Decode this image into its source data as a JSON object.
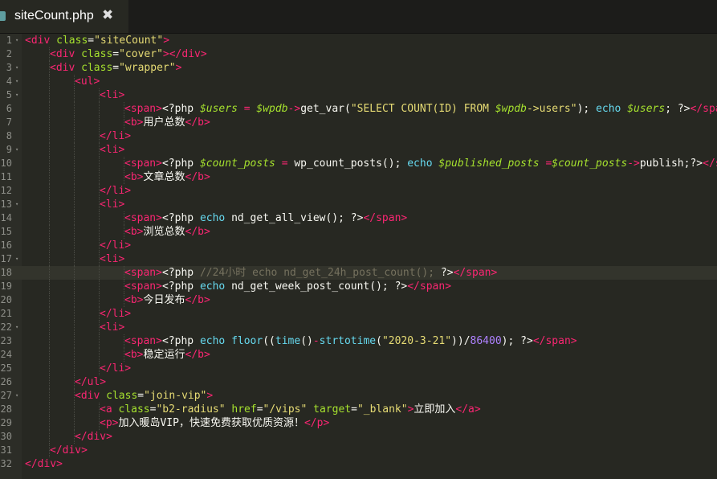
{
  "tab": {
    "title": "siteCount.php",
    "close_glyph": "✖",
    "icon": "file-icon"
  },
  "editor": {
    "active_line": 18,
    "lines": [
      {
        "n": "1",
        "fold": true,
        "indent": 0,
        "tokens": [
          [
            "tag",
            "<div"
          ],
          [
            "txt",
            " "
          ],
          [
            "attr",
            "class"
          ],
          [
            "txt",
            "="
          ],
          [
            "str",
            "\"siteCount\""
          ],
          [
            "tag",
            ">"
          ]
        ]
      },
      {
        "n": "2",
        "fold": false,
        "indent": 1,
        "tokens": [
          [
            "tag",
            "<div"
          ],
          [
            "txt",
            " "
          ],
          [
            "attr",
            "class"
          ],
          [
            "txt",
            "="
          ],
          [
            "str",
            "\"cover\""
          ],
          [
            "tag",
            "></div>"
          ]
        ]
      },
      {
        "n": "3",
        "fold": true,
        "indent": 1,
        "tokens": [
          [
            "tag",
            "<div"
          ],
          [
            "txt",
            " "
          ],
          [
            "attr",
            "class"
          ],
          [
            "txt",
            "="
          ],
          [
            "str",
            "\"wrapper\""
          ],
          [
            "tag",
            ">"
          ]
        ]
      },
      {
        "n": "4",
        "fold": true,
        "indent": 2,
        "tokens": [
          [
            "tag",
            "<ul>"
          ]
        ]
      },
      {
        "n": "5",
        "fold": true,
        "indent": 3,
        "tokens": [
          [
            "tag",
            "<li>"
          ]
        ]
      },
      {
        "n": "6",
        "fold": false,
        "indent": 4,
        "tokens": [
          [
            "tag",
            "<span>"
          ],
          [
            "txt",
            "<?php "
          ],
          [
            "var",
            "$users"
          ],
          [
            "txt",
            " "
          ],
          [
            "op",
            "="
          ],
          [
            "txt",
            " "
          ],
          [
            "var",
            "$wpdb"
          ],
          [
            "op",
            "->"
          ],
          [
            "txt",
            "get_var("
          ],
          [
            "str",
            "\"SELECT COUNT(ID) FROM "
          ],
          [
            "var",
            "$wpdb"
          ],
          [
            "str",
            "->users\""
          ],
          [
            "txt",
            "); "
          ],
          [
            "kw",
            "echo"
          ],
          [
            "txt",
            " "
          ],
          [
            "var",
            "$users"
          ],
          [
            "txt",
            "; ?>"
          ],
          [
            "tag",
            "</span>"
          ]
        ]
      },
      {
        "n": "7",
        "fold": false,
        "indent": 4,
        "tokens": [
          [
            "tag",
            "<b>"
          ],
          [
            "txt",
            "用户总数"
          ],
          [
            "tag",
            "</b>"
          ]
        ]
      },
      {
        "n": "8",
        "fold": false,
        "indent": 3,
        "tokens": [
          [
            "tag",
            "</li>"
          ]
        ]
      },
      {
        "n": "9",
        "fold": true,
        "indent": 3,
        "tokens": [
          [
            "tag",
            "<li>"
          ]
        ]
      },
      {
        "n": "10",
        "fold": false,
        "indent": 4,
        "tokens": [
          [
            "tag",
            "<span>"
          ],
          [
            "txt",
            "<?php "
          ],
          [
            "var",
            "$count_posts"
          ],
          [
            "txt",
            " "
          ],
          [
            "op",
            "="
          ],
          [
            "txt",
            " wp_count_posts(); "
          ],
          [
            "kw",
            "echo"
          ],
          [
            "txt",
            " "
          ],
          [
            "var",
            "$published_posts"
          ],
          [
            "txt",
            " "
          ],
          [
            "op",
            "="
          ],
          [
            "var",
            "$count_posts"
          ],
          [
            "op",
            "->"
          ],
          [
            "txt",
            "publish;?>"
          ],
          [
            "tag",
            "</span>"
          ]
        ]
      },
      {
        "n": "11",
        "fold": false,
        "indent": 4,
        "tokens": [
          [
            "tag",
            "<b>"
          ],
          [
            "txt",
            "文章总数"
          ],
          [
            "tag",
            "</b>"
          ]
        ]
      },
      {
        "n": "12",
        "fold": false,
        "indent": 3,
        "tokens": [
          [
            "tag",
            "</li>"
          ]
        ]
      },
      {
        "n": "13",
        "fold": true,
        "indent": 3,
        "tokens": [
          [
            "tag",
            "<li>"
          ]
        ]
      },
      {
        "n": "14",
        "fold": false,
        "indent": 4,
        "tokens": [
          [
            "tag",
            "<span>"
          ],
          [
            "txt",
            "<?php "
          ],
          [
            "kw",
            "echo"
          ],
          [
            "txt",
            " nd_get_all_view(); ?>"
          ],
          [
            "tag",
            "</span>"
          ]
        ]
      },
      {
        "n": "15",
        "fold": false,
        "indent": 4,
        "tokens": [
          [
            "tag",
            "<b>"
          ],
          [
            "txt",
            "浏览总数"
          ],
          [
            "tag",
            "</b>"
          ]
        ]
      },
      {
        "n": "16",
        "fold": false,
        "indent": 3,
        "tokens": [
          [
            "tag",
            "</li>"
          ]
        ]
      },
      {
        "n": "17",
        "fold": true,
        "indent": 3,
        "tokens": [
          [
            "tag",
            "<li>"
          ]
        ]
      },
      {
        "n": "18",
        "fold": false,
        "indent": 4,
        "tokens": [
          [
            "tag",
            "<span>"
          ],
          [
            "txt",
            "<?php "
          ],
          [
            "cmt",
            "//24小时 echo nd_get_24h_post_count();"
          ],
          [
            "txt",
            " ?>"
          ],
          [
            "tag",
            "</span>"
          ]
        ]
      },
      {
        "n": "19",
        "fold": false,
        "indent": 4,
        "tokens": [
          [
            "tag",
            "<span>"
          ],
          [
            "txt",
            "<?php "
          ],
          [
            "kw",
            "echo"
          ],
          [
            "txt",
            " nd_get_week_post_count(); ?>"
          ],
          [
            "tag",
            "</span>"
          ]
        ]
      },
      {
        "n": "20",
        "fold": false,
        "indent": 4,
        "tokens": [
          [
            "tag",
            "<b>"
          ],
          [
            "txt",
            "今日发布"
          ],
          [
            "tag",
            "</b>"
          ]
        ]
      },
      {
        "n": "21",
        "fold": false,
        "indent": 3,
        "tokens": [
          [
            "tag",
            "</li>"
          ]
        ]
      },
      {
        "n": "22",
        "fold": true,
        "indent": 3,
        "tokens": [
          [
            "tag",
            "<li>"
          ]
        ]
      },
      {
        "n": "23",
        "fold": false,
        "indent": 4,
        "tokens": [
          [
            "tag",
            "<span>"
          ],
          [
            "txt",
            "<?php "
          ],
          [
            "kw",
            "echo"
          ],
          [
            "txt",
            " "
          ],
          [
            "kw",
            "floor"
          ],
          [
            "txt",
            "(("
          ],
          [
            "kw",
            "time"
          ],
          [
            "txt",
            "()"
          ],
          [
            "op",
            "-"
          ],
          [
            "kw",
            "strtotime"
          ],
          [
            "txt",
            "("
          ],
          [
            "str",
            "\"2020-3-21\""
          ],
          [
            "txt",
            "))/"
          ],
          [
            "num",
            "86400"
          ],
          [
            "txt",
            "); ?>"
          ],
          [
            "tag",
            "</span>"
          ]
        ]
      },
      {
        "n": "24",
        "fold": false,
        "indent": 4,
        "tokens": [
          [
            "tag",
            "<b>"
          ],
          [
            "txt",
            "稳定运行"
          ],
          [
            "tag",
            "</b>"
          ]
        ]
      },
      {
        "n": "25",
        "fold": false,
        "indent": 3,
        "tokens": [
          [
            "tag",
            "</li>"
          ]
        ]
      },
      {
        "n": "26",
        "fold": false,
        "indent": 2,
        "tokens": [
          [
            "tag",
            "</ul>"
          ]
        ]
      },
      {
        "n": "27",
        "fold": true,
        "indent": 2,
        "tokens": [
          [
            "tag",
            "<div"
          ],
          [
            "txt",
            " "
          ],
          [
            "attr",
            "class"
          ],
          [
            "txt",
            "="
          ],
          [
            "str",
            "\"join-vip\""
          ],
          [
            "tag",
            ">"
          ]
        ]
      },
      {
        "n": "28",
        "fold": false,
        "indent": 3,
        "tokens": [
          [
            "tag",
            "<a"
          ],
          [
            "txt",
            " "
          ],
          [
            "attr",
            "class"
          ],
          [
            "txt",
            "="
          ],
          [
            "str",
            "\"b2-radius\""
          ],
          [
            "txt",
            " "
          ],
          [
            "attr",
            "href"
          ],
          [
            "txt",
            "="
          ],
          [
            "str",
            "\"/vips\""
          ],
          [
            "txt",
            " "
          ],
          [
            "attr",
            "target"
          ],
          [
            "txt",
            "="
          ],
          [
            "str",
            "\"_blank\""
          ],
          [
            "tag",
            ">"
          ],
          [
            "txt",
            "立即加入"
          ],
          [
            "tag",
            "</a>"
          ]
        ]
      },
      {
        "n": "29",
        "fold": false,
        "indent": 3,
        "tokens": [
          [
            "tag",
            "<p>"
          ],
          [
            "txt",
            "加入暖岛VIP，快速免费获取优质资源！"
          ],
          [
            "tag",
            "</p>"
          ]
        ]
      },
      {
        "n": "30",
        "fold": false,
        "indent": 2,
        "tokens": [
          [
            "tag",
            "</div>"
          ]
        ]
      },
      {
        "n": "31",
        "fold": false,
        "indent": 1,
        "tokens": [
          [
            "tag",
            "</div>"
          ]
        ]
      },
      {
        "n": "32",
        "fold": false,
        "indent": 0,
        "tokens": [
          [
            "tag",
            "</div>"
          ]
        ]
      }
    ]
  },
  "colors": {
    "background": "#272822",
    "tag": "#f92672",
    "attribute": "#a6e22e",
    "string": "#e6db74",
    "keyword": "#66d9ef",
    "number": "#ae81ff",
    "comment": "#75715e"
  }
}
